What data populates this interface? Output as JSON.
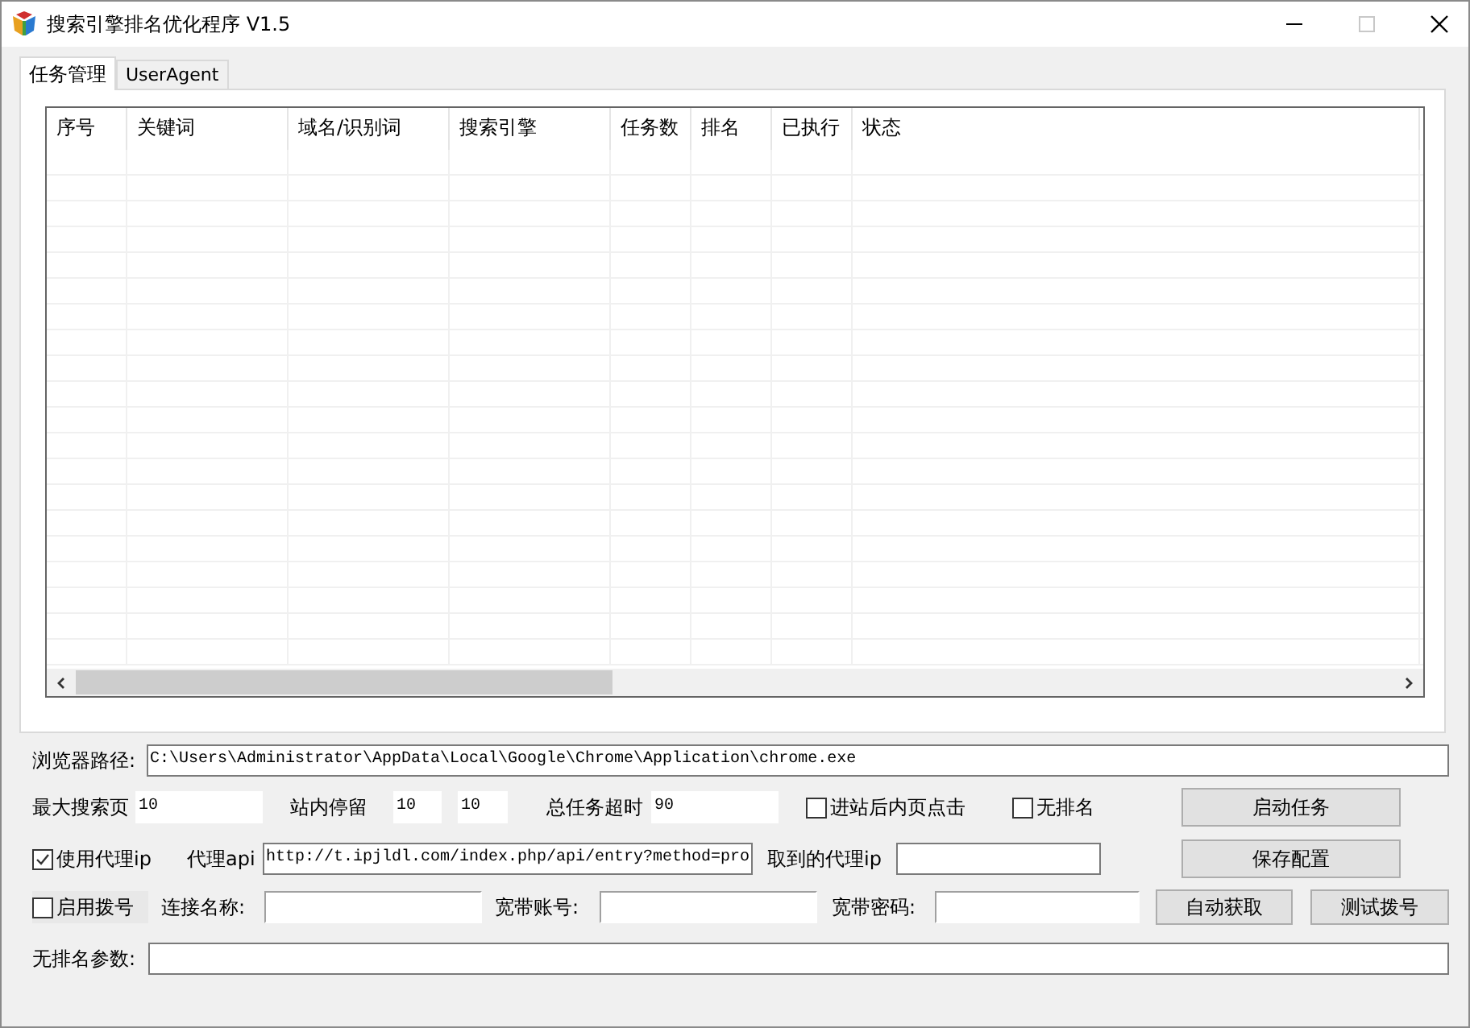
{
  "window": {
    "title": "搜索引擎排名优化程序 V1.5",
    "maximize_disabled": true
  },
  "tabs": [
    {
      "label": "任务管理",
      "selected": true
    },
    {
      "label": "UserAgent",
      "selected": false
    }
  ],
  "table": {
    "columns": [
      "序号",
      "关键词",
      "域名/识别词",
      "搜索引擎",
      "任务数",
      "排名",
      "已执行",
      "状态"
    ]
  },
  "form": [
    [
      {
        "kind": "label",
        "text": "浏览器路径:"
      },
      {
        "kind": "input",
        "value": "C:\\Users\\Administrator\\AppData\\Local\\Google\\Chrome\\Application\\chrome.exe"
      }
    ],
    [
      {
        "kind": "label",
        "text": "最大搜索页"
      },
      {
        "kind": "input",
        "value": "10"
      },
      {
        "kind": "label",
        "text": "站内停留"
      },
      {
        "kind": "input",
        "value": "10"
      },
      {
        "kind": "input",
        "value": "10"
      },
      {
        "kind": "label",
        "text": "总任务超时"
      },
      {
        "kind": "input",
        "value": "90"
      },
      {
        "kind": "checkbox",
        "text": "进站后内页点击",
        "checked": false
      },
      {
        "kind": "checkbox",
        "text": "无排名",
        "checked": false
      },
      {
        "kind": "button",
        "text": "启动任务"
      }
    ],
    [
      {
        "kind": "checkbox",
        "text": "使用代理ip",
        "checked": true
      },
      {
        "kind": "label",
        "text": "代理api"
      },
      {
        "kind": "input",
        "value": "http://t.ipjldl.com/index.php/api/entry?method=pro"
      },
      {
        "kind": "label",
        "text": "取到的代理ip"
      },
      {
        "kind": "input"
      },
      {
        "kind": "button",
        "text": "保存配置"
      }
    ],
    [
      {
        "kind": "checkbox",
        "text": "启用拨号",
        "checked": false
      },
      {
        "kind": "label",
        "text": "连接名称:"
      },
      {
        "kind": "input"
      },
      {
        "kind": "label",
        "text": "宽带账号:"
      },
      {
        "kind": "input"
      },
      {
        "kind": "label",
        "text": "宽带密码:"
      },
      {
        "kind": "input"
      },
      {
        "kind": "button",
        "text": "自动获取"
      },
      {
        "kind": "button",
        "text": "测试拨号"
      }
    ],
    [
      {
        "kind": "label",
        "text": "无排名参数:"
      },
      {
        "kind": "input"
      }
    ]
  ]
}
